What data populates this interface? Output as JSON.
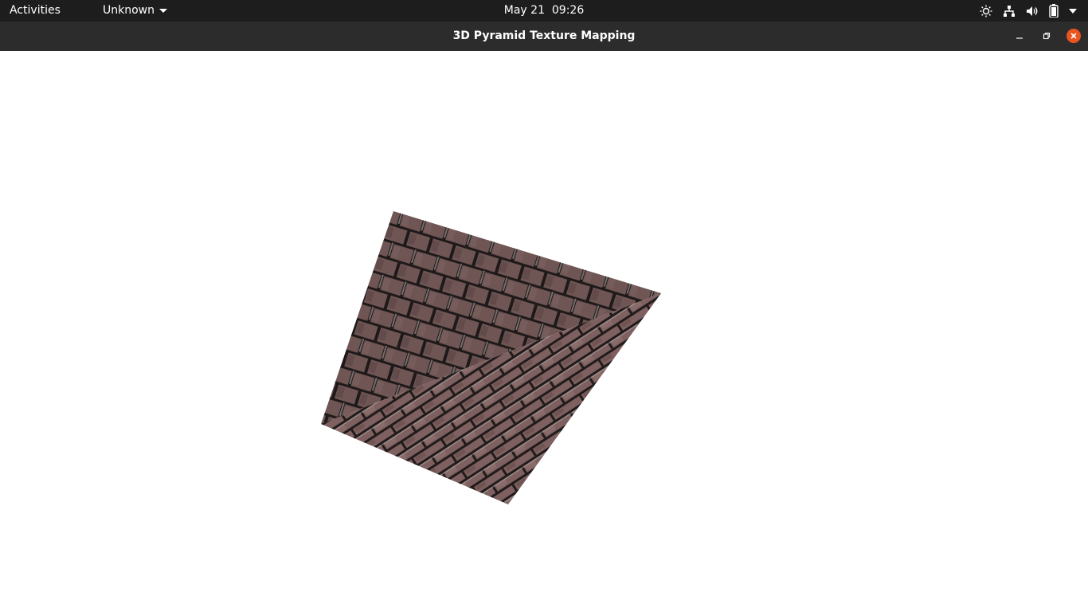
{
  "top_panel": {
    "activities_label": "Activities",
    "app_menu_label": "Unknown",
    "clock": "May 21  09:26",
    "tray_icons": [
      "brightness-icon",
      "network-icon",
      "volume-icon",
      "battery-icon",
      "system-menu-chevron-icon"
    ]
  },
  "window": {
    "title": "3D Pyramid Texture Mapping",
    "controls": [
      "minimize",
      "maximize",
      "close"
    ],
    "accent_color": "#e95420"
  },
  "scene": {
    "object": "pyramid",
    "texture": "brick",
    "texture_colors": {
      "brick": "#6f5554",
      "brick_light": "#8a6a68",
      "mortar": "#1f1a1a",
      "mortar_light": "#c9c4bf"
    }
  }
}
